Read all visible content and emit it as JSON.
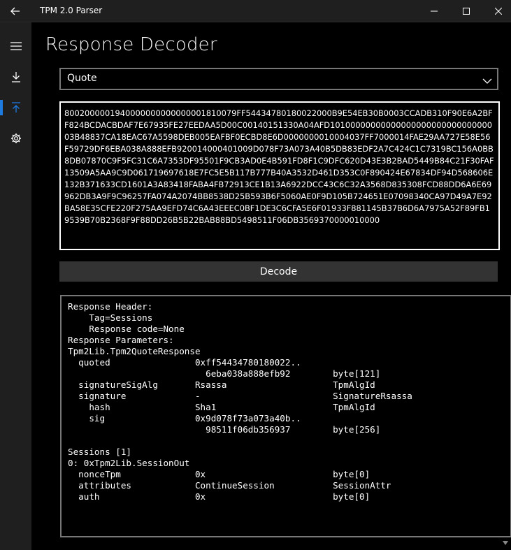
{
  "window": {
    "title": "TPM 2.0 Parser",
    "back_icon": "back-arrow-icon",
    "minimize_icon": "minimize-icon",
    "maximize_icon": "maximize-icon",
    "close_icon": "close-icon"
  },
  "nav": {
    "items": [
      {
        "name": "hamburger-menu",
        "icon": "hamburger-icon"
      },
      {
        "name": "command-decoder",
        "icon": "download-icon"
      },
      {
        "name": "response-decoder",
        "icon": "upload-icon",
        "selected": true
      },
      {
        "name": "settings",
        "icon": "gear-icon"
      }
    ],
    "accent_color": "#1e7be0"
  },
  "page": {
    "title": "Response Decoder"
  },
  "combo": {
    "selected": "Quote"
  },
  "input": {
    "hex": "8002000001940000000000000001810079FF54434780180022000B9E54EB30B0003CCADB310F90E6A2BFF824BCDACBDAF7E67935FE27EEDAA5D00C00140151330A04AFD1010000000000000000000000000000003B48837CA18EAC67A5598DEB005EAFBF0ECBD8E6D0000000010004037FF7000014FAE29AA727E58E56F59729DF6EBA038A888EFB920014000401009D078F73A073A40B5DB83EDF2A7C424C1C7319BC156A0BB8DB07870C9F5FC31C6A7353DF95501F9CB3AD0E4B591FD8F1C9DFC620D43E3B2BAD5449B84C21F30FAF13509A5AA9C9D061719697618E7FC5E5B117B777B40A3532D461D353C0F890424E67834DF94D568606E132B371633CD1601A3A83418FABA4FB72913CE1B13A6922DCC43C6C32A3568D835308FCD88DD6A6E69962DB3A9F9C96257FA074A2074BB8538D25B593B6F5060AE0F9D105B724651E07098340CA97D49A7E92BA58E35CFE220F275AA9EFD74C6A43EEEC0BF1DE3C6CFA5E6F01933F881145B37B6D6A7975A52F89FB19539B70B2368F9F88DD26B5B22BAB88BD5498511F06DB3569370000010000"
  },
  "decode_button": {
    "label": "Decode"
  },
  "output": {
    "text": "Response Header:\n    Tag=Sessions\n    Response code=None\nResponse Parameters:\nTpm2Lib.Tpm2QuoteResponse\n  quoted                0xff54434780180022..\n                          6eba038a888efb92        byte[121]\n  signatureSigAlg       Rsassa                    TpmAlgId\n  signature             -                         SignatureRsassa\n    hash                Sha1                      TpmAlgId\n    sig                 0x9d078f73a073a40b..\n                          98511f06db356937        byte[256]\n\nSessions [1]\n0: 0xTpm2Lib.SessionOut\n  nonceTpm              0x                        byte[0]\n  attributes            ContinueSession           SessionAttr\n  auth                  0x                        byte[0]"
  }
}
